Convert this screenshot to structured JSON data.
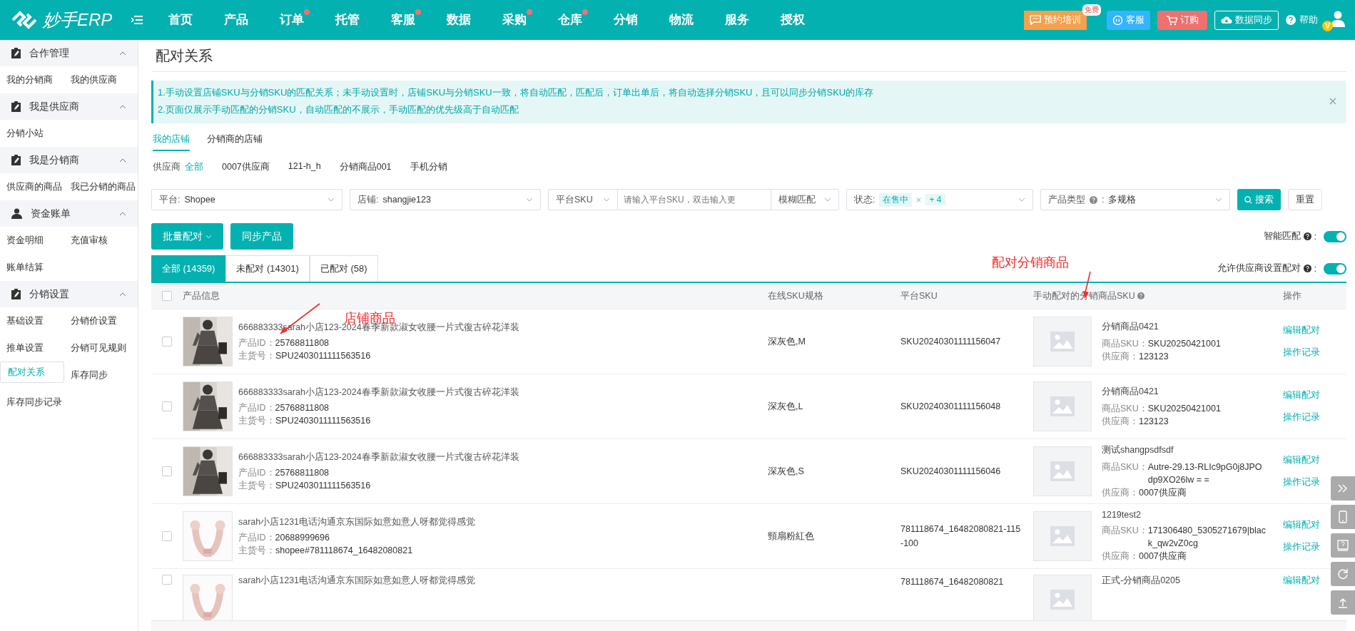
{
  "brand": {
    "name": "妙手ERP"
  },
  "nav": [
    {
      "label": "首页",
      "dot": false
    },
    {
      "label": "产品",
      "dot": false
    },
    {
      "label": "订单",
      "dot": true
    },
    {
      "label": "托管",
      "dot": false
    },
    {
      "label": "客服",
      "dot": true
    },
    {
      "label": "数据",
      "dot": false
    },
    {
      "label": "采购",
      "dot": true
    },
    {
      "label": "仓库",
      "dot": true
    },
    {
      "label": "分销",
      "dot": false
    },
    {
      "label": "物流",
      "dot": false
    },
    {
      "label": "服务",
      "dot": false
    },
    {
      "label": "授权",
      "dot": false
    }
  ],
  "header_actions": {
    "training": {
      "label": "预约培训",
      "badge": "免费"
    },
    "service": "客服",
    "order": "订购",
    "sync": "数据同步",
    "help": "帮助",
    "vip": "V"
  },
  "sidebar": [
    {
      "title": "合作管理",
      "kind": "clipboard",
      "expanded": true,
      "items": [
        {
          "label": "我的分销商",
          "selected": false
        },
        {
          "label": "我的供应商",
          "selected": false
        }
      ]
    },
    {
      "title": "我是供应商",
      "kind": "clipboard",
      "expanded": true,
      "items": [
        {
          "label": "分销小站",
          "selected": false
        }
      ]
    },
    {
      "title": "我是分销商",
      "kind": "clipboard",
      "expanded": true,
      "items": [
        {
          "label": "供应商的商品",
          "selected": false
        },
        {
          "label": "我已分销的商品",
          "selected": false
        }
      ]
    },
    {
      "title": "资金账单",
      "kind": "person",
      "expanded": true,
      "items": [
        {
          "label": "资金明细",
          "selected": false
        },
        {
          "label": "充值审核",
          "selected": false
        },
        {
          "label": "账单结算",
          "selected": false
        }
      ]
    },
    {
      "title": "分销设置",
      "kind": "clipboard",
      "expanded": true,
      "items": [
        {
          "label": "基础设置",
          "selected": false
        },
        {
          "label": "分销价设置",
          "selected": false
        },
        {
          "label": "推单设置",
          "selected": false
        },
        {
          "label": "分销可见规则",
          "selected": false
        },
        {
          "label": "配对关系",
          "selected": true
        },
        {
          "label": "库存同步",
          "selected": false
        },
        {
          "label": "库存同步记录",
          "selected": false
        }
      ]
    }
  ],
  "page_title": "配对关系",
  "notice": [
    "1.手动设置店铺SKU与分销SKU的匹配关系；未手动设置时，店铺SKU与分销SKU一致，将自动匹配，匹配后，订单出单后，将自动选择分销SKU，且可以同步分销SKU的库存",
    "2.页面仅展示手动匹配的分销SKU，自动匹配的不展示，手动匹配的优先级高于自动匹配"
  ],
  "store_tabs": [
    {
      "label": "我的店铺",
      "selected": true
    },
    {
      "label": "分销商的店铺",
      "selected": false
    }
  ],
  "supplier_filter": {
    "label": "供应商",
    "options": [
      {
        "label": "全部",
        "selected": true
      },
      {
        "label": "0007供应商",
        "selected": false
      },
      {
        "label": "121-h_h",
        "selected": false
      },
      {
        "label": "分销商品001",
        "selected": false
      },
      {
        "label": "手机分销",
        "selected": false
      }
    ]
  },
  "filters": {
    "platform": {
      "label": "平台:",
      "value": "Shopee"
    },
    "store": {
      "label": "店铺:",
      "value": "shangjie123"
    },
    "sku_type": "平台SKU",
    "sku_input": {
      "placeholder": "请输入平台SKU，双击输入更"
    },
    "match_mode": "模糊匹配",
    "status": {
      "label": "状态:",
      "tags": [
        "在售中"
      ],
      "more": "+ 4"
    },
    "product_type": {
      "label": "产品类型",
      "colon": ":",
      "value": "多规格"
    },
    "search": "搜索",
    "reset": "重置"
  },
  "actions": {
    "batch": "批量配对",
    "sync": "同步产品"
  },
  "toggles": [
    {
      "label": "智能匹配",
      "colon": ":",
      "on": true
    },
    {
      "label": "允许供应商设置配对",
      "colon": ":",
      "on": true
    }
  ],
  "status_tabs": [
    {
      "label": "全部 (14359)",
      "selected": true
    },
    {
      "label": "未配对 (14301)",
      "selected": false
    },
    {
      "label": "已配对 (58)",
      "selected": false
    }
  ],
  "table": {
    "all_checked": false,
    "columns": [
      "产品信息",
      "在线SKU规格",
      "平台SKU",
      "手动配对的分销商品SKU",
      "操作"
    ],
    "rows": [
      {
        "checked": false,
        "title": "666883333sarah小店123-2024春季新款淑女收腰一片式復古碎花洋装",
        "product_id_label": "产品ID：",
        "product_id": "25768811808",
        "item_no_label": "主货号：",
        "item_no": "SPU2403011111563516",
        "spec": "深灰色,M",
        "platform_sku": "SKU20240301111156047",
        "dist_name": "分销商品0421",
        "dist_sku_label": "商品SKU：",
        "dist_sku": "SKU20250421001",
        "supplier_label": "供应商：",
        "supplier": "123123",
        "actions": [
          "编辑配对",
          "操作记录"
        ]
      },
      {
        "checked": false,
        "title": "666883333sarah小店123-2024春季新款淑女收腰一片式復古碎花洋装",
        "product_id_label": "产品ID：",
        "product_id": "25768811808",
        "item_no_label": "主货号：",
        "item_no": "SPU2403011111563516",
        "spec": "深灰色,L",
        "platform_sku": "SKU20240301111156048",
        "dist_name": "分销商品0421",
        "dist_sku_label": "商品SKU：",
        "dist_sku": "SKU20250421001",
        "supplier_label": "供应商：",
        "supplier": "123123",
        "actions": [
          "编辑配对",
          "操作记录"
        ]
      },
      {
        "checked": false,
        "title": "666883333sarah小店123-2024春季新款淑女收腰一片式復古碎花洋装",
        "product_id_label": "产品ID：",
        "product_id": "25768811808",
        "item_no_label": "主货号：",
        "item_no": "SPU2403011111563516",
        "spec": "深灰色,S",
        "platform_sku": "SKU20240301111156046",
        "dist_name": "测试shangpsdfsdf",
        "dist_sku_label": "商品SKU：",
        "dist_sku": "Autre-29.13-RLIc9pG0j8JPOdp9XO26lw = =",
        "supplier_label": "供应商：",
        "supplier": "0007供应商",
        "actions": [
          "编辑配对",
          "操作记录"
        ]
      },
      {
        "checked": false,
        "title": "sarah小店1231电话沟通京东国际如意如意人呀都觉得感觉",
        "product_id_label": "产品ID：",
        "product_id": "20688999696",
        "item_no_label": "主货号：",
        "item_no": "shopee#781118674_16482080821",
        "spec": "頸扇粉紅色",
        "platform_sku": "781118674_16482080821-115-100",
        "dist_name": "1219test2",
        "dist_sku_label": "商品SKU：",
        "dist_sku": "171306480_5305271679|black_qw2vZ0cg",
        "supplier_label": "供应商：",
        "supplier": "0007供应商",
        "actions": [
          "编辑配对",
          "操作记录"
        ]
      },
      {
        "checked": false,
        "title": "sarah小店1231电话沟通京东国际如意如意人呀都觉得感觉",
        "platform_sku": "781118674_16482080821",
        "dist_name": "正式-分销商品0205",
        "actions": [
          "编辑配对"
        ]
      }
    ]
  },
  "annotations": [
    {
      "text": "店铺商品"
    },
    {
      "text": "配对分销商品"
    }
  ]
}
